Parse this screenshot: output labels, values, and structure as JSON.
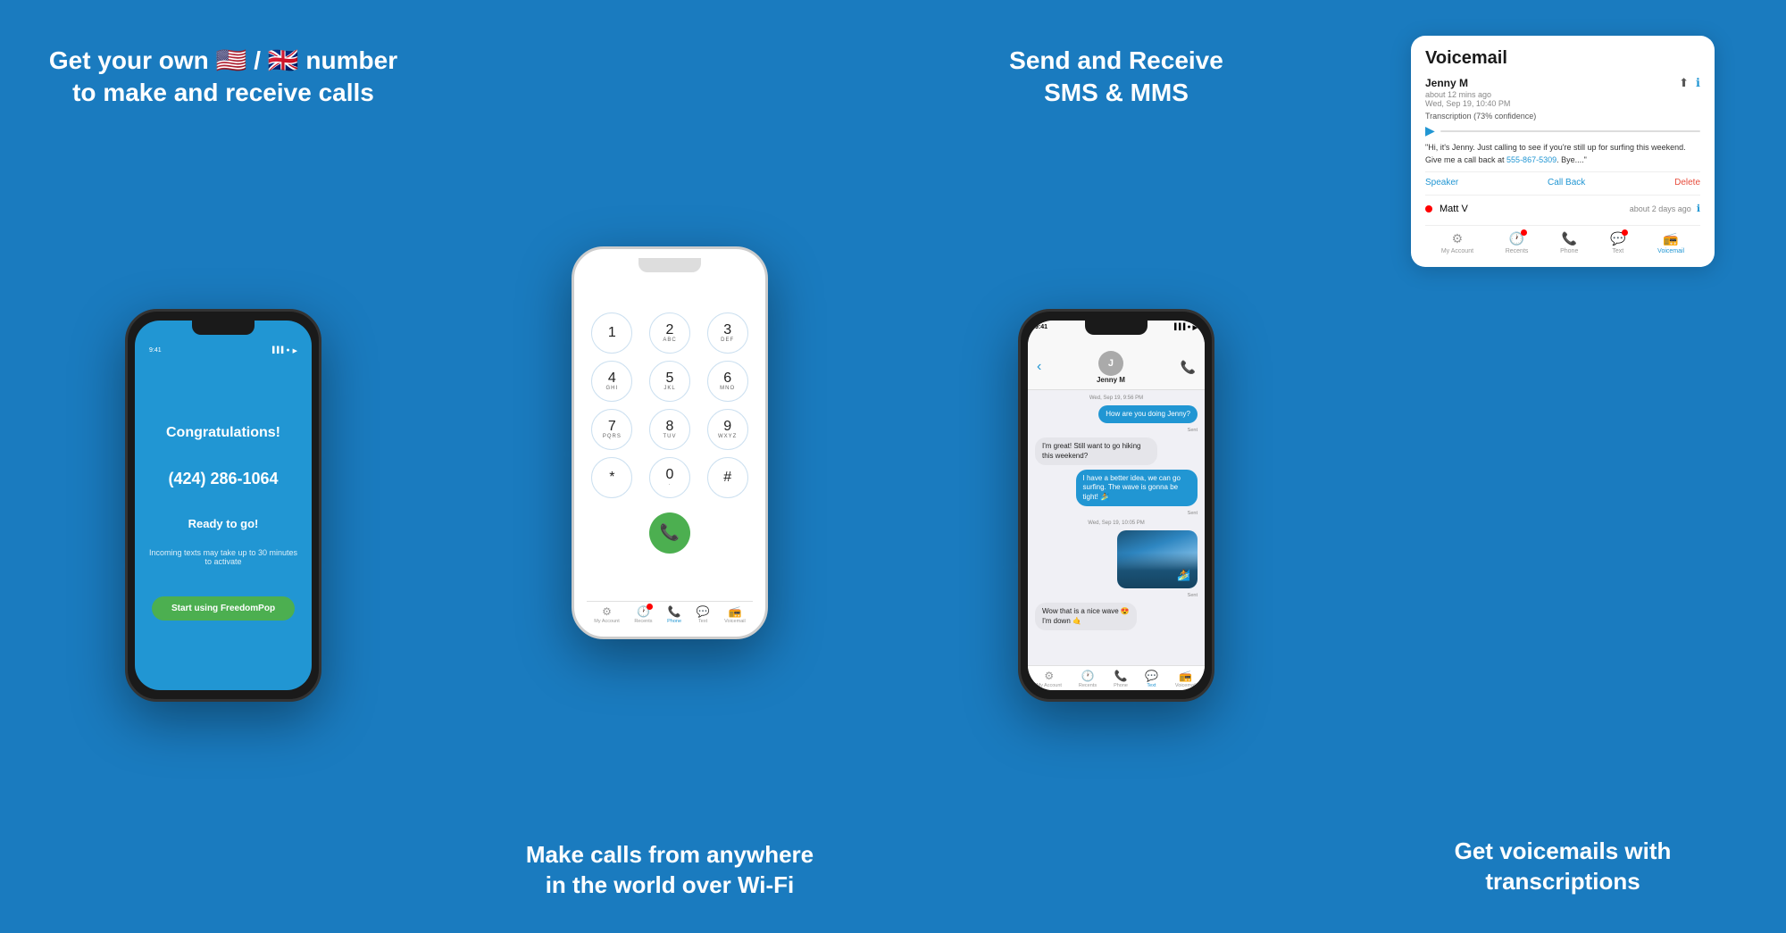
{
  "panel1": {
    "title": "Get your own 🇺🇸 / 🇬🇧 number\nto make and receive calls",
    "screen": {
      "status_time": "9:41",
      "congrats": "Congratulations!",
      "phone_number": "(424) 286-1064",
      "ready": "Ready to go!",
      "incoming_note": "Incoming texts may take up to 30 minutes\nto activate",
      "start_btn": "Start using FreedomPop"
    }
  },
  "panel2": {
    "title": "Make calls from anywhere\nin the world over Wi-Fi",
    "dialer": {
      "keys": [
        {
          "num": "1",
          "sub": ""
        },
        {
          "num": "2",
          "sub": "ABC"
        },
        {
          "num": "3",
          "sub": "DEF"
        },
        {
          "num": "4",
          "sub": "GHI"
        },
        {
          "num": "5",
          "sub": "JKL"
        },
        {
          "num": "6",
          "sub": "MNO"
        },
        {
          "num": "7",
          "sub": "PQRS"
        },
        {
          "num": "8",
          "sub": "TUV"
        },
        {
          "num": "9",
          "sub": "WXYZ"
        },
        {
          "num": "*",
          "sub": ""
        },
        {
          "num": "0",
          "sub": "·"
        },
        {
          "num": "#",
          "sub": ""
        }
      ]
    },
    "tabs": [
      {
        "label": "My Account",
        "icon": "⚙",
        "active": false,
        "badge": false
      },
      {
        "label": "Recents",
        "icon": "🕐",
        "active": false,
        "badge": true
      },
      {
        "label": "Phone",
        "icon": "📞",
        "active": true,
        "badge": false
      },
      {
        "label": "Text",
        "icon": "💬",
        "active": false,
        "badge": false
      },
      {
        "label": "Voicemail",
        "icon": "📻",
        "active": false,
        "badge": false
      }
    ]
  },
  "panel3": {
    "title": "Send and Receive\nSMS & MMS",
    "screen": {
      "status_time": "9:41",
      "contact_name": "Jenny M",
      "msg_date1": "Wed, Sep 19, 9:56 PM",
      "msg1": "How are you doing Jenny?",
      "msg1_sent": "Sent",
      "msg2": "I'm great! Still want to go hiking this weekend?",
      "msg_date2": "Wed, Sep 19, 10:05 PM",
      "msg3": "I have a better idea, we can go surfing. The wave is gonna be tight! 🏄",
      "msg3_sent": "Sent",
      "msg_date3": "Wed, Sep 19, 10:05 PM",
      "msg4_sent": "Sent",
      "msg5": "Wow that is a nice wave 😍\nI'm down 🤙"
    },
    "tabs": [
      {
        "label": "My Account",
        "icon": "⚙",
        "active": false,
        "badge": false
      },
      {
        "label": "Recents",
        "icon": "🕐",
        "active": false,
        "badge": false
      },
      {
        "label": "Phone",
        "icon": "📞",
        "active": false,
        "badge": false
      },
      {
        "label": "Text",
        "icon": "💬",
        "active": true,
        "badge": false
      },
      {
        "label": "Voicemail",
        "icon": "📻",
        "active": false,
        "badge": false
      }
    ]
  },
  "panel4": {
    "title": "Get voicemails with\ntranscriptions",
    "card": {
      "section_title": "Voicemail",
      "caller1_name": "Jenny M",
      "caller1_time": "about 12 mins ago",
      "caller1_date": "Wed, Sep 19, 10:40 PM",
      "transcript_label": "Transcription (73% confidence)",
      "transcript": "\"Hi, it's Jenny. Just calling to see if you're still up for surfing this weekend. Give me a call back at 555-867-5309. Bye....\"",
      "phone_link": "555-867-5309",
      "action_speaker": "Speaker",
      "action_callback": "Call Back",
      "action_delete": "Delete",
      "caller2_name": "Matt V",
      "caller2_time": "about 2 days ago"
    },
    "tabs": [
      {
        "label": "My Account",
        "icon": "⚙",
        "active": false,
        "badge": false
      },
      {
        "label": "Recents",
        "icon": "🕐",
        "active": false,
        "badge": true
      },
      {
        "label": "Phone",
        "icon": "📞",
        "active": false,
        "badge": false
      },
      {
        "label": "Text",
        "icon": "💬",
        "active": false,
        "badge": true
      },
      {
        "label": "Voicemail",
        "icon": "📻",
        "active": true,
        "badge": false
      }
    ]
  }
}
